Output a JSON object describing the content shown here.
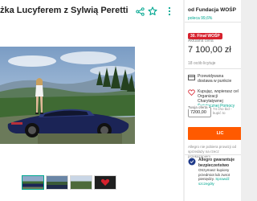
{
  "title": "żka Lucyferem z Sylwią Peretti",
  "icons": [
    "share-icon",
    "star-icon",
    "more-icon"
  ],
  "thumbnails_count": 4,
  "seller": {
    "name": "od Fundacja WOŚP",
    "rating": "poleca 99,6%"
  },
  "auction": {
    "badge": "30. Finał WOŚP",
    "current_label": "Aktualna cena",
    "price": "7 100,00 zł",
    "offers": "18 ocób licytuje"
  },
  "delivery": {
    "estimated": "Przewidywana dostawa w punkcie"
  },
  "charity": {
    "text_prefix": "Kupując, wspierasz cel Organizacji Charytatywnej",
    "link": "Świątecznej Pomocy"
  },
  "bid": {
    "label": "Twoja oferta",
    "value": "7200,00",
    "min_note": "74 cho bid - kupić to",
    "button": "LIC"
  },
  "agreement": "Allegro nie pobiera prowizji od sprzedaży na rzecz przekazaniem",
  "guarantee": {
    "title": "Allegro gwarantuje bezpieczeństwo",
    "text": "Otrzymasz kupiony przedmiot lub zwrot pieniędzy.",
    "link": "Sprawdź szczegóły"
  },
  "colors": {
    "accent": "#00a790",
    "bid_button": "#ff5a00",
    "badge": "#d6212d"
  }
}
